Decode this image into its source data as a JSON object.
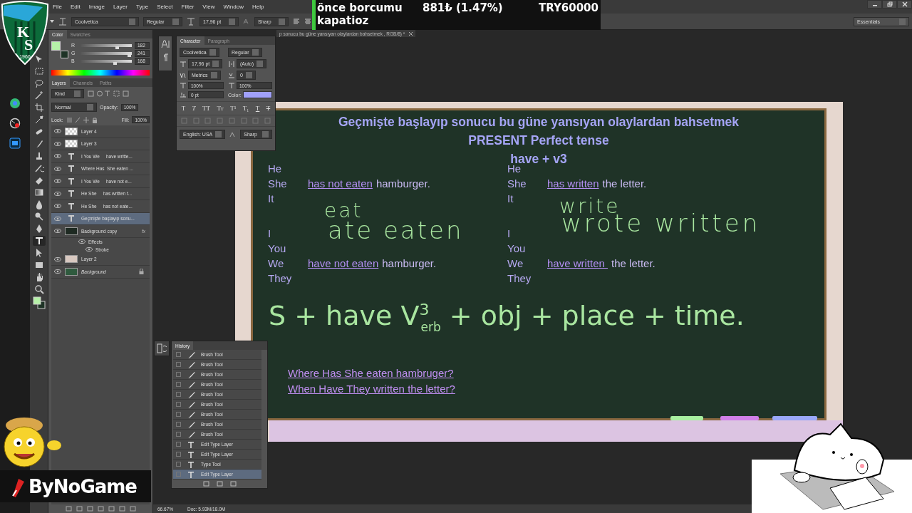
{
  "menu": [
    "File",
    "Edit",
    "Image",
    "Layer",
    "Type",
    "Select",
    "Filter",
    "View",
    "Window",
    "Help"
  ],
  "options_bar": {
    "font": "Coolvetica",
    "style": "Regular",
    "size": "17,96 pt",
    "antialias": "Sharp"
  },
  "workspace": "Essentials",
  "ticker": {
    "line1": [
      "önce borcumu",
      "881₺ (1.47%)",
      "TRY60000"
    ],
    "line2": "kapatioz"
  },
  "club_logo": {
    "letters": [
      "K",
      "S"
    ],
    "year": "1966"
  },
  "tools": [
    {
      "kind": "move",
      "selected": false
    },
    {
      "kind": "marquee",
      "selected": false
    },
    {
      "kind": "lasso",
      "selected": false
    },
    {
      "kind": "wand",
      "selected": false
    },
    {
      "kind": "crop",
      "selected": false
    },
    {
      "kind": "eyedropper",
      "selected": false
    },
    {
      "kind": "heal",
      "selected": false
    },
    {
      "kind": "brush",
      "selected": false
    },
    {
      "kind": "stamp",
      "selected": false
    },
    {
      "kind": "history",
      "selected": false
    },
    {
      "kind": "eraser",
      "selected": false
    },
    {
      "kind": "gradient",
      "selected": false
    },
    {
      "kind": "blur",
      "selected": false
    },
    {
      "kind": "dodge",
      "selected": false
    },
    {
      "kind": "pen",
      "selected": false
    },
    {
      "kind": "type",
      "selected": true
    },
    {
      "kind": "select",
      "selected": false
    },
    {
      "kind": "shape",
      "selected": false
    },
    {
      "kind": "hand",
      "selected": false
    },
    {
      "kind": "zoom",
      "selected": false
    }
  ],
  "color_panel": {
    "tabs": [
      {
        "label": "Color",
        "selected": true
      },
      {
        "label": "Swatches",
        "selected": false
      }
    ],
    "channels": [
      {
        "label": "R",
        "value": "182",
        "level": 0.71
      },
      {
        "label": "G",
        "value": "241",
        "level": 0.945
      },
      {
        "label": "B",
        "value": "168",
        "level": 0.66
      }
    ]
  },
  "layers_panel": {
    "tabs": [
      {
        "label": "Layers",
        "selected": true
      },
      {
        "label": "Channels",
        "selected": false
      },
      {
        "label": "Paths",
        "selected": false
      }
    ],
    "filter": "Kind",
    "blend_mode": "Normal",
    "opacity_label": "Opacity:",
    "opacity": "100%",
    "lock_label": "Lock:",
    "fill_label": "Fill:",
    "fill": "100%",
    "layers": [
      {
        "name": "Layer 4",
        "kind": "image",
        "selected": false
      },
      {
        "name": "Layer 3",
        "kind": "image",
        "selected": false
      },
      {
        "name": "I You We     have writte...",
        "kind": "text",
        "selected": false
      },
      {
        "name": "Where Has  She eaten ...",
        "kind": "text",
        "selected": false
      },
      {
        "name": "I You We     have not e...",
        "kind": "text",
        "selected": false
      },
      {
        "name": "He She     has written t...",
        "kind": "text",
        "selected": false
      },
      {
        "name": "He She     has not eate...",
        "kind": "text",
        "selected": false
      },
      {
        "name": "Geçmişte başlayıp sonu...",
        "kind": "text",
        "selected": true
      },
      {
        "name": "Background copy",
        "kind": "board",
        "selected": false,
        "badge": "fx",
        "effects_label": "Effects",
        "effects": [
          "Stroke"
        ]
      },
      {
        "name": "Layer 2",
        "kind": "frame",
        "selected": false
      },
      {
        "name": "Background",
        "kind": "background",
        "selected": false
      }
    ]
  },
  "character_panel": {
    "tabs": [
      {
        "label": "Character",
        "selected": true
      },
      {
        "label": "Paragraph",
        "selected": false
      }
    ],
    "font": "Coolvetica",
    "style": "Regular",
    "size": "17,96 pt",
    "leading": "(Auto)",
    "kerning": "Metrics",
    "tracking": "0",
    "vertical_scale": "100%",
    "horizontal_scale": "100%",
    "baseline": "0 pt",
    "color_label": "Color:",
    "style_buttons": [
      {
        "label": "T",
        "kind": "bold"
      },
      {
        "label": "T",
        "kind": "italic"
      },
      {
        "label": "TT",
        "kind": "caps"
      },
      {
        "label": "Tт",
        "kind": "smallcaps"
      },
      {
        "label": "T¹",
        "kind": "super"
      },
      {
        "label": "T₁",
        "kind": "sub"
      },
      {
        "label": "T",
        "kind": "underline"
      },
      {
        "label": "T",
        "kind": "strike"
      }
    ],
    "language": "English: USA",
    "antialias": "Sharp"
  },
  "history_panel": {
    "title": "History",
    "items": [
      {
        "label": "Brush Tool",
        "kind": "brush",
        "selected": false
      },
      {
        "label": "Brush Tool",
        "kind": "brush",
        "selected": false
      },
      {
        "label": "Brush Tool",
        "kind": "brush",
        "selected": false
      },
      {
        "label": "Brush Tool",
        "kind": "brush",
        "selected": false
      },
      {
        "label": "Brush Tool",
        "kind": "brush",
        "selected": false
      },
      {
        "label": "Brush Tool",
        "kind": "brush",
        "selected": false
      },
      {
        "label": "Brush Tool",
        "kind": "brush",
        "selected": false
      },
      {
        "label": "Brush Tool",
        "kind": "brush",
        "selected": false
      },
      {
        "label": "Brush Tool",
        "kind": "brush",
        "selected": false
      },
      {
        "label": "Edit Type Layer",
        "kind": "type",
        "selected": false
      },
      {
        "label": "Edit Type Layer",
        "kind": "type",
        "selected": false
      },
      {
        "label": "Type Tool",
        "kind": "type",
        "selected": false
      },
      {
        "label": "Edit Type Layer",
        "kind": "type",
        "selected": true
      }
    ]
  },
  "document_tab": "p sonucu bu güne yansıyan olaylardan bahsetmek , RGB/8) *",
  "board": {
    "title_lines": [
      "Geçmişte başlayıp sonucu bu güne yansıyan olaylardan bahsetmek",
      "PRESENT Perfect tense",
      "have + v3"
    ],
    "columns": [
      {
        "groups": [
          [
            {
              "pronoun": "He"
            },
            {
              "pronoun": "She",
              "verb": "has not eaten",
              "rest": "hamburger."
            },
            {
              "pronoun": "It"
            }
          ],
          [
            {
              "pronoun": "I"
            },
            {
              "pronoun": "You"
            },
            {
              "pronoun": "We",
              "verb": "have not eaten",
              "rest": "hamburger."
            },
            {
              "pronoun": "They"
            }
          ]
        ]
      },
      {
        "groups": [
          [
            {
              "pronoun": "He"
            },
            {
              "pronoun": "She",
              "verb": "has written",
              "rest": "the letter."
            },
            {
              "pronoun": "It"
            }
          ],
          [
            {
              "pronoun": "I"
            },
            {
              "pronoun": "You"
            },
            {
              "pronoun": "We",
              "verb": "have written ",
              "rest": "the letter."
            },
            {
              "pronoun": "They"
            }
          ]
        ]
      }
    ],
    "handwriting": [
      "eat",
      "ate eaten",
      "write",
      "wrote written"
    ],
    "formula": "S + have V$^{3}$$_{erb}$ + obj + place + time.",
    "questions": [
      "Where Has  She eaten hambruger?",
      "When Have They written the letter?"
    ]
  },
  "status_bar": {
    "zoom": "66.67%",
    "doc": "Doc: 5.93M/18.0M"
  },
  "brand": {
    "name": "ByNoGame"
  }
}
